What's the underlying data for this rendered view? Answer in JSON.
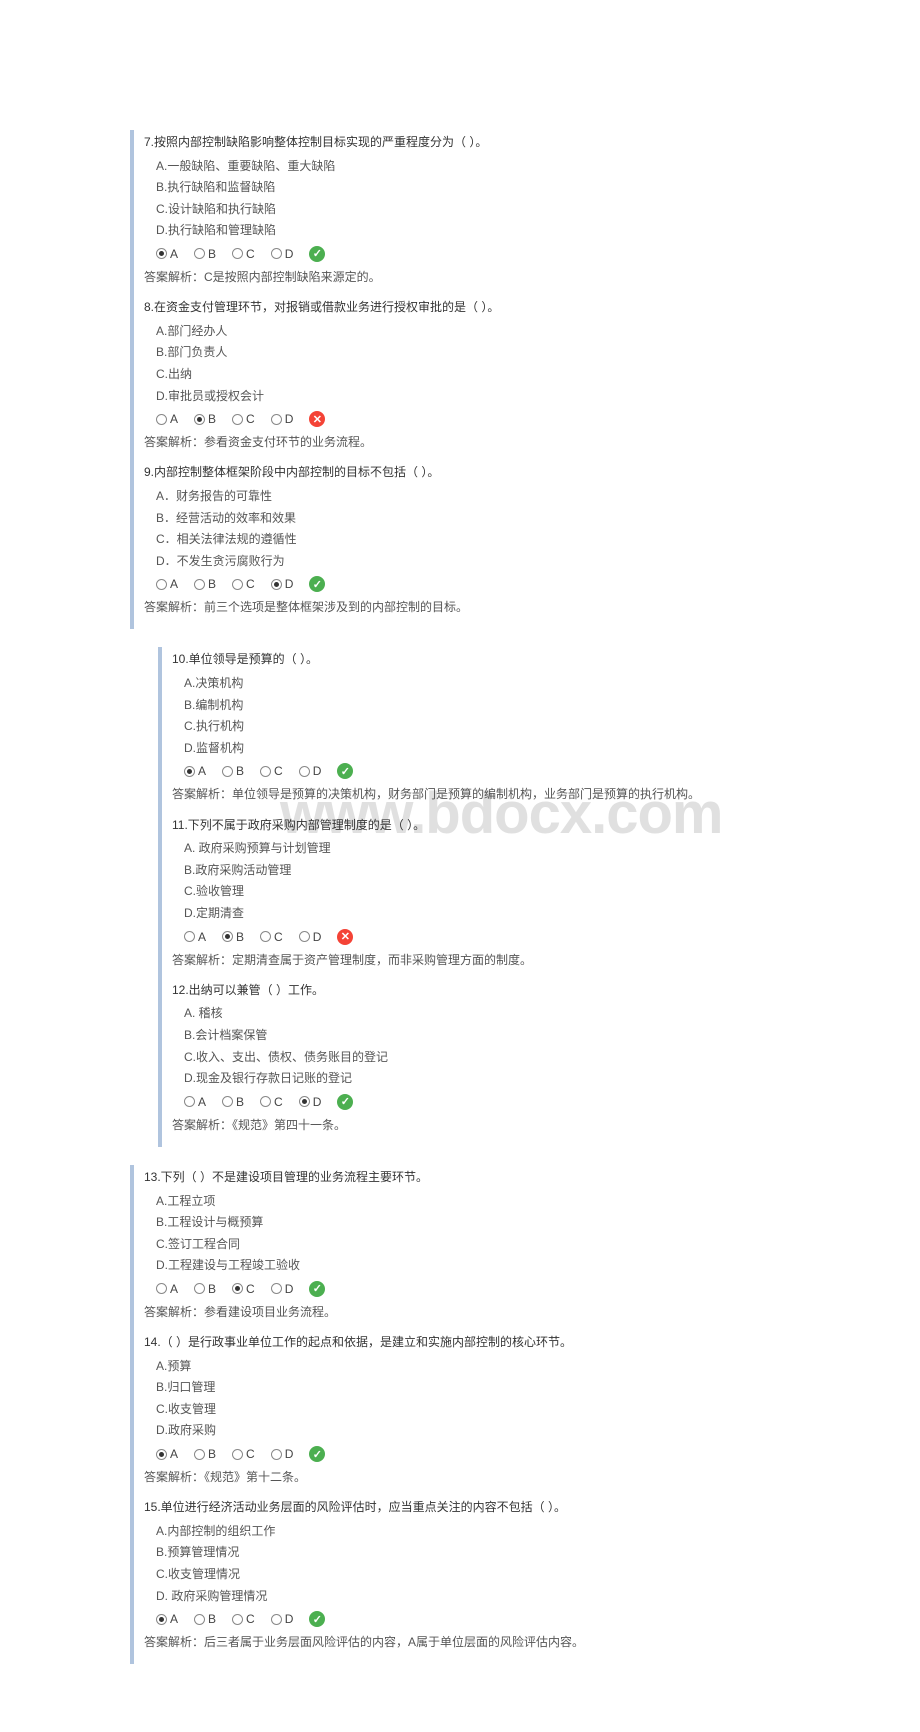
{
  "watermark": "www.bdocx.com",
  "labels": {
    "A": "A",
    "B": "B",
    "C": "C",
    "D": "D"
  },
  "questions": [
    {
      "num": "7",
      "text": "7.按照内部控制缺陷影响整体控制目标实现的严重程度分为（ ）。",
      "options": [
        "A.一般缺陷、重要缺陷、重大缺陷",
        "B.执行缺陷和监督缺陷",
        "C.设计缺陷和执行缺陷",
        "D.执行缺陷和管理缺陷"
      ],
      "selected": "A",
      "result": "correct",
      "explain": "答案解析：C是按照内部控制缺陷来源定的。",
      "indent": false
    },
    {
      "num": "8",
      "text": "8.在资金支付管理环节，对报销或借款业务进行授权审批的是（ ）。",
      "options": [
        "A.部门经办人",
        "B.部门负责人",
        "C.出纳",
        "D.审批员或授权会计"
      ],
      "selected": "B",
      "result": "wrong",
      "explain": "答案解析：参看资金支付环节的业务流程。",
      "indent": false
    },
    {
      "num": "9",
      "text": "9.内部控制整体框架阶段中内部控制的目标不包括（ ）。",
      "options": [
        "A．财务报告的可靠性",
        "B．经营活动的效率和效果",
        "C．相关法律法规的遵循性",
        "D．不发生贪污腐败行为"
      ],
      "selected": "D",
      "result": "correct",
      "explain": "答案解析：前三个选项是整体框架涉及到的内部控制的目标。",
      "indent": false
    },
    {
      "num": "10",
      "text": "10.单位领导是预算的（ ）。",
      "options": [
        "A.决策机构",
        "B.编制机构",
        "C.执行机构",
        "D.监督机构"
      ],
      "selected": "A",
      "result": "correct",
      "explain": "答案解析：单位领导是预算的决策机构，财务部门是预算的编制机构，业务部门是预算的执行机构。",
      "indent": true
    },
    {
      "num": "11",
      "text": "11.下列不属于政府采购内部管理制度的是（ ）。",
      "options": [
        "A. 政府采购预算与计划管理",
        "B.政府采购活动管理",
        "C.验收管理",
        "D.定期清查"
      ],
      "selected": "B",
      "result": "wrong",
      "explain": "答案解析：定期清查属于资产管理制度，而非采购管理方面的制度。",
      "indent": true
    },
    {
      "num": "12",
      "text": "12.出纳可以兼管（ ）工作。",
      "options": [
        "A. 稽核",
        "B.会计档案保管",
        "C.收入、支出、债权、债务账目的登记",
        "D.现金及银行存款日记账的登记"
      ],
      "selected": "D",
      "result": "correct",
      "explain": "答案解析：《规范》第四十一条。",
      "indent": true
    },
    {
      "num": "13",
      "text": "13.下列（ ）不是建设项目管理的业务流程主要环节。",
      "options": [
        "A.工程立项",
        "B.工程设计与概预算",
        "C.签订工程合同",
        "D.工程建设与工程竣工验收"
      ],
      "selected": "C",
      "result": "correct",
      "explain": "答案解析：参看建设项目业务流程。",
      "indent": false
    },
    {
      "num": "14",
      "text": "14.（ ）是行政事业单位工作的起点和依据，是建立和实施内部控制的核心环节。",
      "options": [
        "A.预算",
        "B.归口管理",
        "C.收支管理",
        "D.政府采购"
      ],
      "selected": "A",
      "result": "correct",
      "explain": "答案解析：《规范》第十二条。",
      "indent": false
    },
    {
      "num": "15",
      "text": "15.单位进行经济活动业务层面的风险评估时，应当重点关注的内容不包括（ ）。",
      "options": [
        "A.内部控制的组织工作",
        "B.预算管理情况",
        "C.收支管理情况",
        "D. 政府采购管理情况"
      ],
      "selected": "A",
      "result": "correct",
      "explain": "答案解析：后三者属于业务层面风险评估的内容，A属于单位层面的风险评估内容。",
      "indent": false
    }
  ]
}
